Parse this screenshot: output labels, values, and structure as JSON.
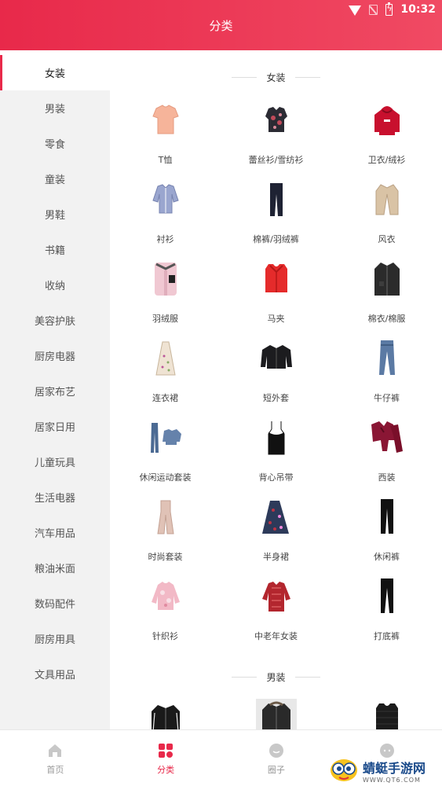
{
  "status_bar": {
    "time": "10:32"
  },
  "header": {
    "title": "分类"
  },
  "sidebar": {
    "items": [
      "女装",
      "男装",
      "零食",
      "童装",
      "男鞋",
      "书籍",
      "收纳",
      "美容护肤",
      "厨房电器",
      "居家布艺",
      "居家日用",
      "儿童玩具",
      "生活电器",
      "汽车用品",
      "粮油米面",
      "数码配件",
      "厨房用具",
      "文具用品"
    ],
    "active_index": 0
  },
  "sections": [
    {
      "title": "女装",
      "items": [
        {
          "label": "T恤",
          "icon": "tshirt-icon"
        },
        {
          "label": "蕾丝衫/雪纺衫",
          "icon": "lace-top-icon"
        },
        {
          "label": "卫衣/绒衫",
          "icon": "hoodie-icon"
        },
        {
          "label": "衬衫",
          "icon": "shirt-icon"
        },
        {
          "label": "棉裤/羽绒裤",
          "icon": "padded-pants-icon"
        },
        {
          "label": "风衣",
          "icon": "trench-coat-icon"
        },
        {
          "label": "羽绒服",
          "icon": "down-jacket-icon"
        },
        {
          "label": "马夹",
          "icon": "vest-icon"
        },
        {
          "label": "棉衣/棉服",
          "icon": "cotton-coat-icon"
        },
        {
          "label": "连衣裙",
          "icon": "dress-icon"
        },
        {
          "label": "短外套",
          "icon": "short-jacket-icon"
        },
        {
          "label": "牛仔裤",
          "icon": "jeans-icon"
        },
        {
          "label": "休闲运动套装",
          "icon": "sport-set-icon"
        },
        {
          "label": "背心吊带",
          "icon": "camisole-icon"
        },
        {
          "label": "西装",
          "icon": "suit-icon"
        },
        {
          "label": "时尚套装",
          "icon": "fashion-set-icon"
        },
        {
          "label": "半身裙",
          "icon": "skirt-icon"
        },
        {
          "label": "休闲裤",
          "icon": "casual-pants-icon"
        },
        {
          "label": "针织衫",
          "icon": "knit-sweater-icon"
        },
        {
          "label": "中老年女装",
          "icon": "senior-womenswear-icon"
        },
        {
          "label": "打底裤",
          "icon": "leggings-icon"
        }
      ]
    },
    {
      "title": "男装",
      "items": [
        {
          "label": "",
          "icon": "mens-jacket-icon"
        },
        {
          "label": "",
          "icon": "mens-parka-icon"
        },
        {
          "label": "",
          "icon": "mens-vest-icon"
        }
      ]
    }
  ],
  "bottom_nav": {
    "items": [
      {
        "label": "首页",
        "icon": "home-icon"
      },
      {
        "label": "分类",
        "icon": "category-icon"
      },
      {
        "label": "圈子",
        "icon": "chat-icon"
      },
      {
        "label": "",
        "icon": "message-icon"
      }
    ],
    "active_index": 1
  },
  "watermark": {
    "title": "蜻蜓手游网",
    "sub": "WWW.QT6.COM"
  },
  "colors": {
    "accent": "#e8294a",
    "header_start": "#e8294a",
    "header_end": "#f04a63",
    "sidebar_bg": "#f2f2f2"
  }
}
